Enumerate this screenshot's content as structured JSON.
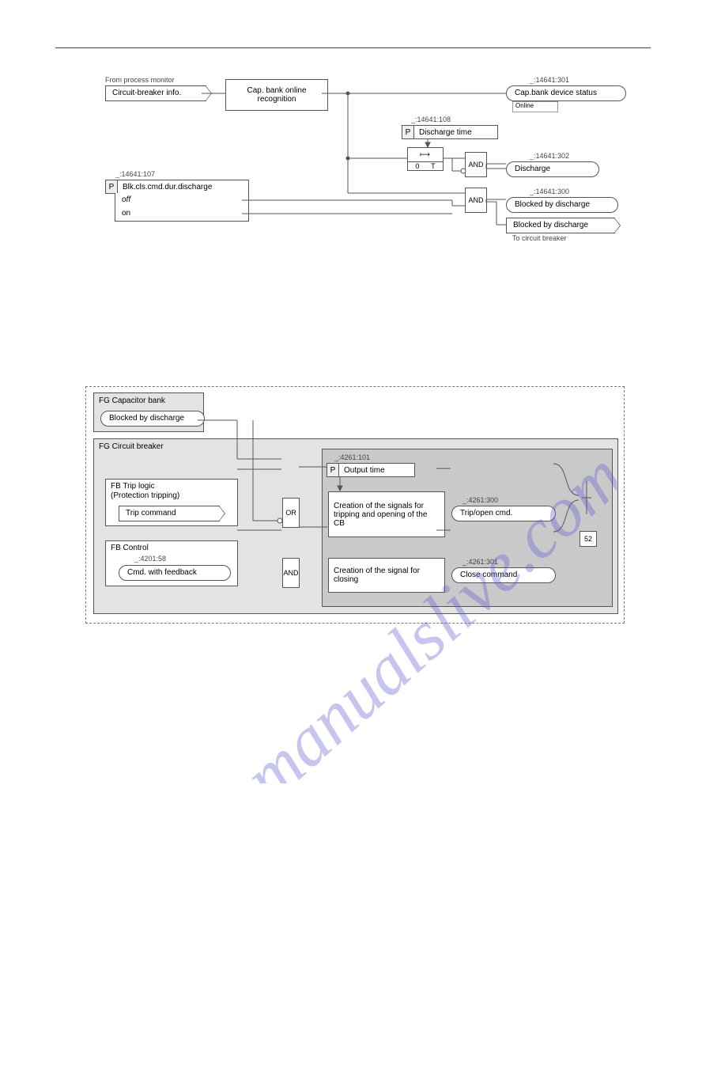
{
  "top_rule": true,
  "upper": {
    "cb_info": {
      "caption": "From process monitor",
      "label": "Circuit-breaker info."
    },
    "cap_recog": "Cap. bank online\nrecognition",
    "cap_status": {
      "id": "_:14641:301",
      "label": "Cap.bank device status",
      "note": "Online"
    },
    "discharge_time": {
      "id": "_:14641:108",
      "label": "Discharge time"
    },
    "timer": {
      "left": "0",
      "right": "T"
    },
    "blk_param": {
      "id": "_:14641:107",
      "label": "Blk.cls.cmd.dur.discharge",
      "options": [
        "off",
        "on"
      ]
    },
    "discharge_out": {
      "id": "_:14641:302",
      "label": "Discharge"
    },
    "blocked_out": {
      "id": "_:14641:300",
      "label": "Blocked by discharge"
    },
    "blocked_arrow": {
      "label": "Blocked by discharge",
      "note": "To circuit breaker"
    },
    "gates": {
      "and": "AND"
    }
  },
  "lower": {
    "fg_cap": {
      "title": "FG Capacitor bank",
      "sig_blocked": "Blocked by discharge"
    },
    "fg_cb": {
      "title": "FG Circuit breaker",
      "output_time": {
        "id": "_:4261:101",
        "label": "Output time"
      },
      "trip_logic": {
        "title1": "FB Trip logic",
        "title2": "(Protection tripping)",
        "sig": "Trip command"
      },
      "control": {
        "title": "FB Control",
        "id": "_:4201:58",
        "sig": "Cmd. with feedback"
      },
      "or": "OR",
      "and": "AND",
      "proc_open": "Creation of the signals for tripping and opening of the CB",
      "proc_close": "Creation of the signal for closing",
      "out_open": {
        "id": "_:4261:300",
        "label": "Trip/open cmd."
      },
      "out_close": {
        "id": "_:4261:301",
        "label": "Close command"
      },
      "device": "52"
    }
  },
  "watermark": "manualslive.com"
}
